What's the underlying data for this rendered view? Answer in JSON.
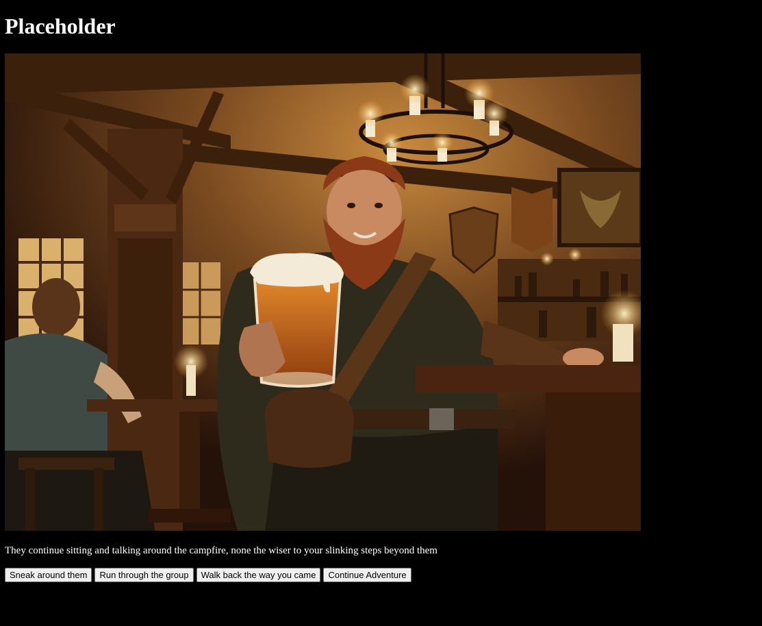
{
  "page": {
    "title": "Placeholder",
    "narration": "They continue sitting and talking around the campfire, none the wiser to your slinking steps beyond them"
  },
  "scene": {
    "description_icon": "tavern-dwarf-ale-illustration",
    "palette": {
      "shadow": "#1e0f05",
      "wood": "#5a3417",
      "warm_light": "#e8a54a",
      "ale": "#c9621a",
      "beard": "#8a3a17",
      "foam": "#f3ead8"
    }
  },
  "choices": [
    {
      "label": "Sneak around them"
    },
    {
      "label": "Run through the group"
    },
    {
      "label": "Walk back the way you came"
    },
    {
      "label": "Continue Adventure"
    }
  ]
}
